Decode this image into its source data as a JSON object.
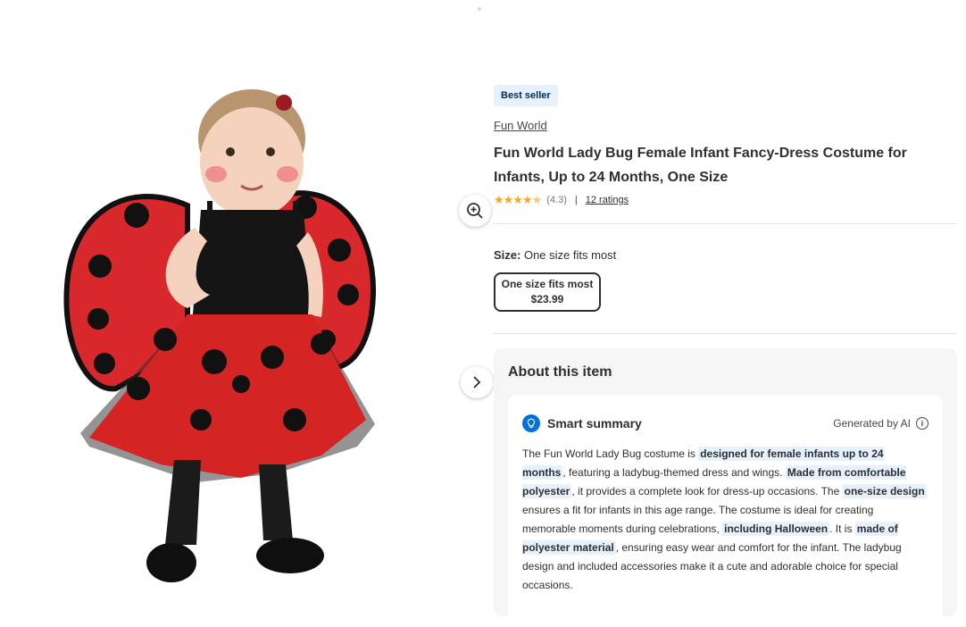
{
  "product": {
    "badge": "Best seller",
    "brand": "Fun World",
    "title": "Fun World Lady Bug Female Infant Fancy-Dress Costume for Infants, Up to 24 Months, One Size",
    "rating_stars": 4.3,
    "rating_value": "(4.3)",
    "rating_separator": "|",
    "ratings_count": "12 ratings"
  },
  "size": {
    "label": "Size:",
    "selected": "One size fits most",
    "options": [
      {
        "label": "One size fits most",
        "price": "$23.99"
      }
    ]
  },
  "about": {
    "title": "About this item",
    "summary_title": "Smart summary",
    "generated_by": "Generated by AI",
    "info_glyph": "i",
    "summary_parts": [
      {
        "t": "The Fun World Lady Bug costume is "
      },
      {
        "t": "designed for female infants up to 24 months",
        "hl": true
      },
      {
        "t": ", featuring a ladybug-themed dress and wings. "
      },
      {
        "t": "Made from comfortable polyester",
        "hl": true
      },
      {
        "t": ", it provides a complete look for dress-up occasions. The "
      },
      {
        "t": "one-size design",
        "hl": true
      },
      {
        "t": " ensures a fit for infants in this age range. The costume is ideal for creating memorable moments during celebrations, "
      },
      {
        "t": "including Halloween",
        "hl": true
      },
      {
        "t": ". It is "
      },
      {
        "t": "made of polyester material",
        "hl": true
      },
      {
        "t": ", ensuring easy wear and comfort for the infant. The ladybug design and included accessories make it a cute and adorable choice for special occasions."
      }
    ]
  },
  "icons": {
    "zoom": "zoom-in-icon",
    "next": "chevron-right-icon",
    "summary": "lightbulb-icon",
    "info": "info-icon"
  },
  "colors": {
    "accent": "#0071dc",
    "badge_bg": "#e6f1fc",
    "highlight_bg": "#e6f1fc",
    "star": "#f5a623"
  }
}
